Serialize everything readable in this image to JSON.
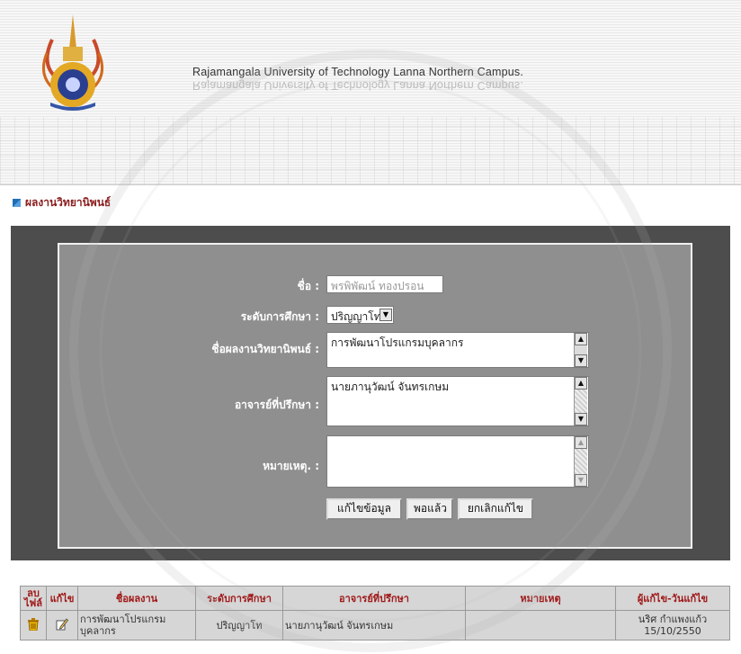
{
  "header": {
    "university_name": "Rajamangala University of Technology Lanna Northern Campus."
  },
  "section": {
    "title": "ผลงานวิทยานิพนธ์"
  },
  "form": {
    "name_label": "ชื่อ :",
    "name_value": "พรพิพัฒน์ ทองปรอน",
    "level_label": "ระดับการศึกษา :",
    "level_value": "ปริญญาโท",
    "thesis_label": "ชื่อผลงานวิทยานิพนธ์ :",
    "thesis_value": "การพัฒนาโปรแกรมบุคลากร",
    "advisor_label": "อาจารย์ที่ปรึกษา :",
    "advisor_value": "นายภานุวัฒน์ จันทรเกษม",
    "note_label": "หมายเหตุ. :",
    "note_value": ""
  },
  "buttons": {
    "edit": "แก้ไขข้อมูล",
    "done": "พอแล้ว",
    "cancel": "ยกเลิกแก้ไข"
  },
  "table": {
    "headers": {
      "delete_line1": "ลบ",
      "delete_line2": "ไฟล์",
      "edit": "แก้ไข",
      "title": "ชื่อผลงาน",
      "level": "ระดับการศึกษา",
      "advisor": "อาจารย์ที่ปรึกษา",
      "note": "หมายเหตุ",
      "editor_date": "ผู้แก้ไข-วันแก้ไข"
    },
    "rows": [
      {
        "title": "การพัฒนาโปรแกรมบุคลากร",
        "level": "ปริญญาโท",
        "advisor": "นายภานุวัฒน์ จันทรเกษม",
        "note": "",
        "editor": "นริศ กำแพงแก้ว",
        "date": "15/10/2550"
      }
    ]
  },
  "icons": {
    "delete": "trash-icon",
    "edit": "edit-icon",
    "section_bullet": "square-bullet-icon"
  },
  "colors": {
    "header_text": "#a01818",
    "section_title": "#8b1c1c",
    "outer_bg": "#4d4d4d",
    "panel_bg": "#8f8f8f"
  }
}
